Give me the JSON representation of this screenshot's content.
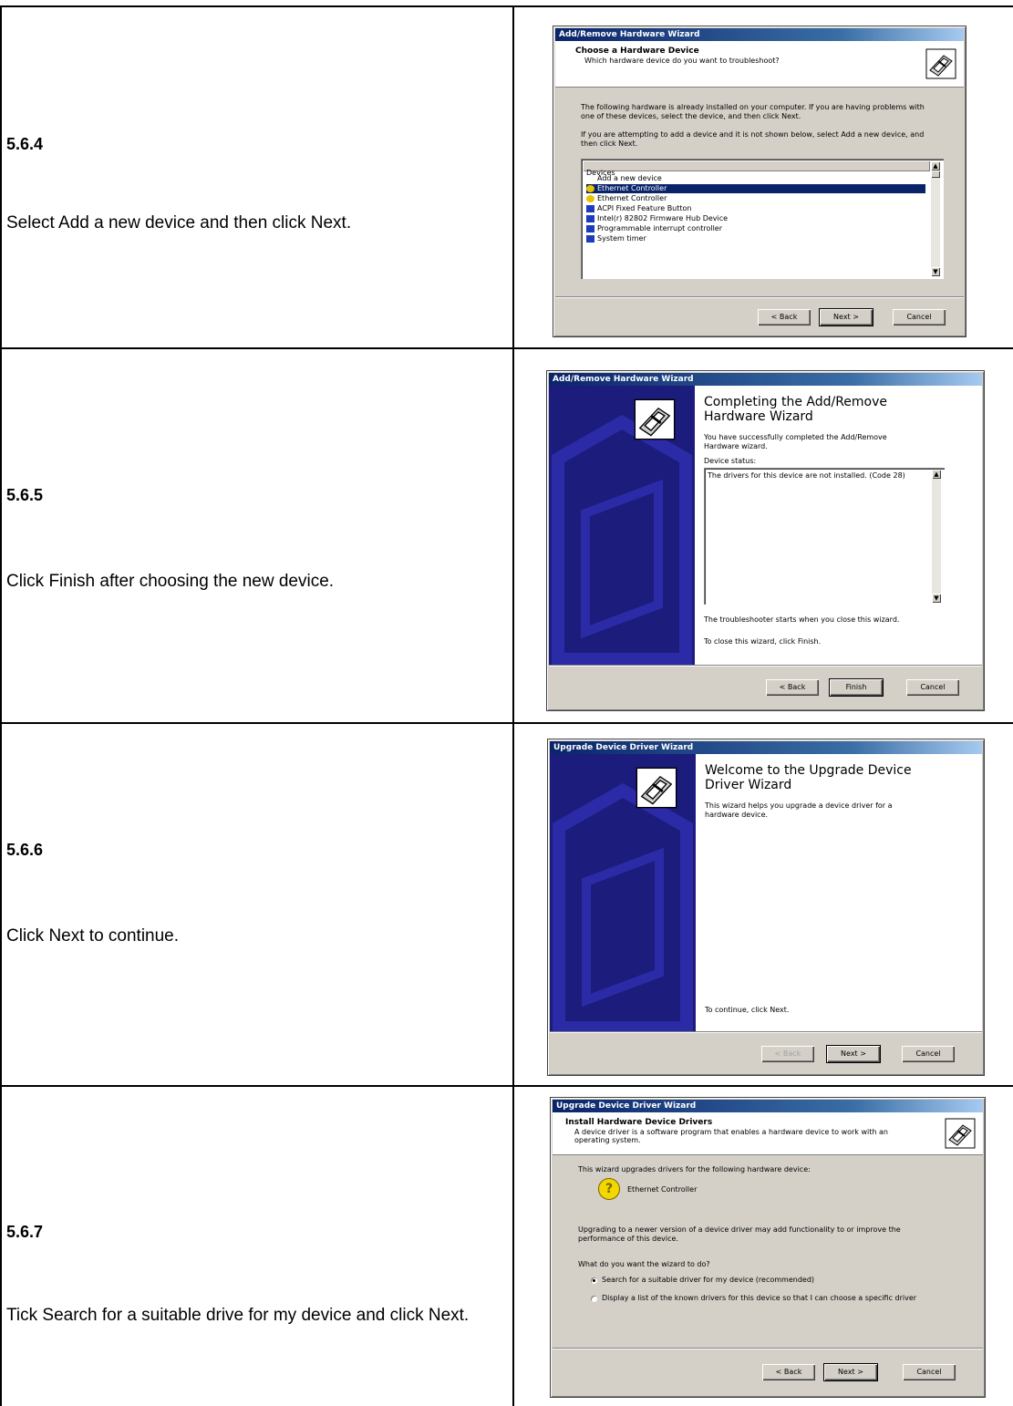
{
  "steps": [
    {
      "number": "5.6.4",
      "description": "Select Add a new device and then click Next.",
      "dialog": {
        "title": "Add/Remove Hardware Wizard",
        "header_title": "Choose a Hardware Device",
        "header_subtitle": "Which hardware device do you want to troubleshoot?",
        "para1": "The following hardware is already installed on your computer. If you are having problems with one of these devices, select the device, and then click Next.",
        "para2": "If you are attempting to add a device and it is not shown below, select Add a new device, and then click Next.",
        "list_header": "Devices",
        "list_items": [
          "Add a new device",
          "Ethernet Controller",
          "Ethernet Controller",
          "ACPI Fixed Feature Button",
          "Intel(r) 82802 Firmware Hub Device",
          "Programmable interrupt controller",
          "System timer"
        ],
        "buttons": {
          "back": "< Back",
          "next": "Next >",
          "cancel": "Cancel"
        }
      }
    },
    {
      "number": "5.6.5",
      "description": "Click Finish after choosing the new device.",
      "dialog": {
        "title": "Add/Remove Hardware Wizard",
        "big_title": "Completing the Add/Remove Hardware Wizard",
        "text1": "You have successfully completed the Add/Remove Hardware wizard.",
        "status_label": "Device status:",
        "status_text": "The drivers for this device are not installed. (Code 28)",
        "text2": "The troubleshooter starts when you close this wizard.",
        "text3": "To close this wizard, click Finish.",
        "buttons": {
          "back": "< Back",
          "finish": "Finish",
          "cancel": "Cancel"
        }
      }
    },
    {
      "number": "5.6.6",
      "description": "Click Next to continue.",
      "dialog": {
        "title": "Upgrade Device Driver Wizard",
        "big_title": "Welcome to the Upgrade Device Driver Wizard",
        "text1": "This wizard helps you upgrade a device driver for a hardware device.",
        "text2": "To continue, click Next.",
        "buttons": {
          "back": "< Back",
          "next": "Next >",
          "cancel": "Cancel"
        }
      }
    },
    {
      "number": "5.6.7",
      "description": "Tick Search for a suitable drive for my device and click Next.",
      "dialog": {
        "title": "Upgrade Device Driver Wizard",
        "header_title": "Install Hardware Device Drivers",
        "header_subtitle": "A device driver is a software program that enables a hardware device to work with an operating system.",
        "text1": "This wizard upgrades drivers for the following hardware device:",
        "device_name": "Ethernet Controller",
        "text2": "Upgrading to a newer version of a device driver may add functionality to or improve the performance of this device.",
        "question": "What do you want the wizard to do?",
        "option1": "Search for a suitable driver for my device (recommended)",
        "option2": "Display a list of the known drivers for this device so that I can choose a specific driver",
        "buttons": {
          "back": "< Back",
          "next": "Next >",
          "cancel": "Cancel"
        }
      }
    }
  ]
}
